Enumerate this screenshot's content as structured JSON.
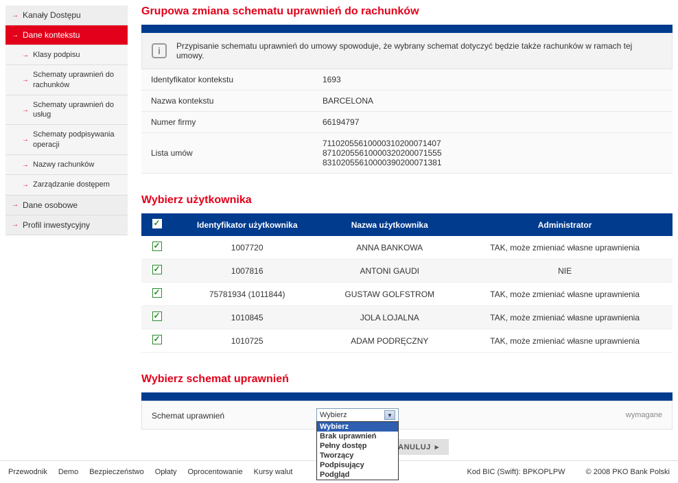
{
  "sidebar": {
    "items": [
      {
        "label": "Kanały Dostępu"
      },
      {
        "label": "Dane kontekstu"
      },
      {
        "label": "Klasy podpisu"
      },
      {
        "label": "Schematy uprawnień do rachunków"
      },
      {
        "label": "Schematy uprawnień do usług"
      },
      {
        "label": "Schematy podpisywania operacji"
      },
      {
        "label": "Nazwy rachunków"
      },
      {
        "label": "Zarządzanie dostępem"
      },
      {
        "label": "Dane osobowe"
      },
      {
        "label": "Profil inwestycyjny"
      }
    ]
  },
  "page_title": "Grupowa zmiana schematu uprawnień do rachunków",
  "info_text": "Przypisanie schematu uprawnień do umowy spowoduje, że wybrany schemat dotyczyć będzie także rachunków w ramach tej umowy.",
  "context": {
    "id_label": "Identyfikator kontekstu",
    "id_value": "1693",
    "name_label": "Nazwa kontekstu",
    "name_value": "BARCELONA",
    "company_label": "Numer firmy",
    "company_value": "66194797",
    "contracts_label": "Lista umów",
    "contracts_value": "71102055610000310200071407\n87102055610000320200071555\n83102055610000390200071381"
  },
  "users_title": "Wybierz użytkownika",
  "users_headers": {
    "id": "Identyfikator użytkownika",
    "name": "Nazwa użytkownika",
    "admin": "Administrator"
  },
  "users": [
    {
      "id": "1007720",
      "name": "ANNA BANKOWA",
      "admin": "TAK, może zmieniać własne uprawnienia"
    },
    {
      "id": "1007816",
      "name": "ANTONI GAUDI",
      "admin": "NIE"
    },
    {
      "id": "75781934 (1011844)",
      "name": "GUSTAW GOLFSTROM",
      "admin": "TAK, może zmieniać własne uprawnienia"
    },
    {
      "id": "1010845",
      "name": "JOLA LOJALNA",
      "admin": "TAK, może zmieniać własne uprawnienia"
    },
    {
      "id": "1010725",
      "name": "ADAM PODRĘCZNY",
      "admin": "TAK, może zmieniać własne uprawnienia"
    }
  ],
  "schema_title": "Wybierz schemat uprawnień",
  "schema_label": "Schemat uprawnień",
  "schema_required": "wymagane",
  "schema_selected": "Wybierz",
  "schema_options": [
    "Wybierz",
    "Brak uprawnień",
    "Pełny dostęp",
    "Tworzący",
    "Podpisujący",
    "Podgląd"
  ],
  "buttons": {
    "cancel": "ANULUJ"
  },
  "footer": {
    "links": [
      "Przewodnik",
      "Demo",
      "Bezpieczeństwo",
      "Opłaty",
      "Oprocentowanie",
      "Kursy walut"
    ],
    "bic": "Kod BIC (Swift): BPKOPLPW",
    "copyright": "© 2008 PKO Bank Polski"
  }
}
